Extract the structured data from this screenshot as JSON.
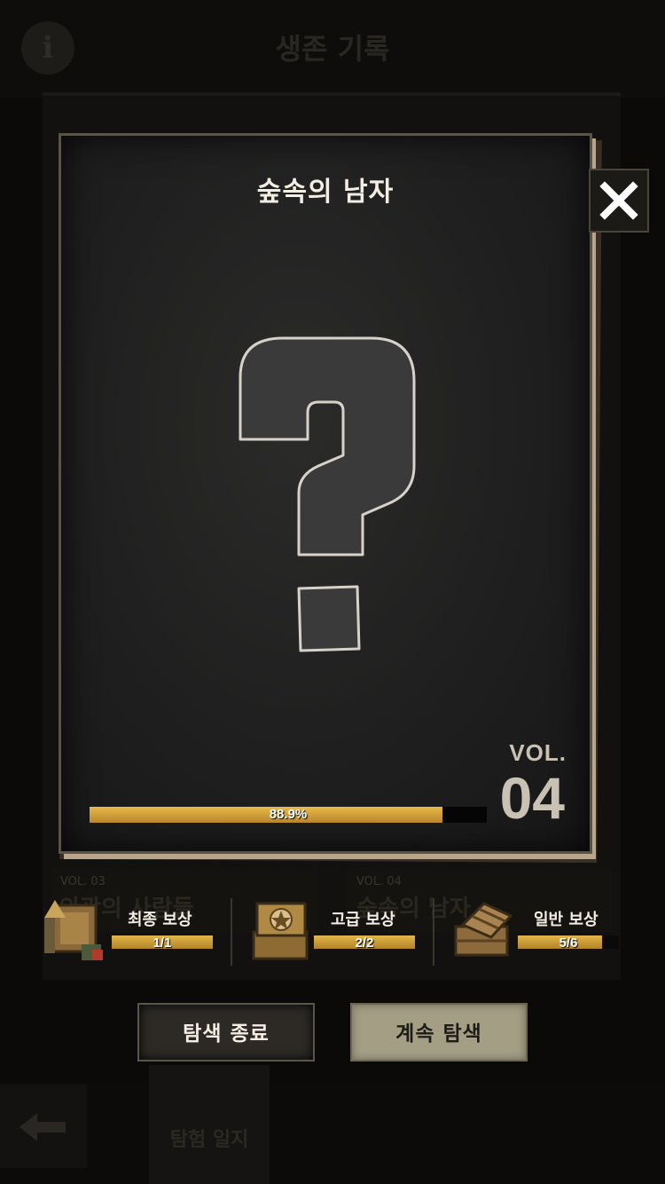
{
  "background": {
    "title": "생존 기록",
    "info_icon_glyph": "i",
    "cards": [
      {
        "vol": "VOL. 03",
        "name": "의광의 사람들"
      },
      {
        "vol": "VOL. 04",
        "name": "숲속의 남자"
      }
    ],
    "journal_tab_label": "탐험 일지"
  },
  "book": {
    "title": "숲속의 남자",
    "vol_label": "VOL.",
    "vol_number": "04",
    "progress_percent": 88.9,
    "progress_text": "88.9%"
  },
  "rewards": [
    {
      "label": "최종 보상",
      "count_text": "1/1",
      "current": 1,
      "total": 1,
      "icon": "ammo-crate-icon"
    },
    {
      "label": "고급 보상",
      "count_text": "2/2",
      "current": 2,
      "total": 2,
      "icon": "star-crate-icon"
    },
    {
      "label": "일반 보상",
      "count_text": "5/6",
      "current": 5,
      "total": 6,
      "icon": "wooden-crate-icon"
    }
  ],
  "buttons": {
    "end_label": "탐색 종료",
    "continue_label": "계속 탐색"
  },
  "colors": {
    "progress_gold": "#d9a83e",
    "continue_button": "#a49e85",
    "end_button": "#2d2a25"
  }
}
